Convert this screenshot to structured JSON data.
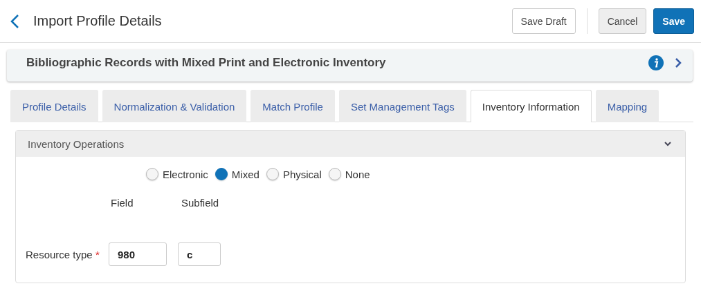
{
  "header": {
    "title": "Import Profile Details",
    "buttons": [
      {
        "label": "Save Draft",
        "kind": "outline"
      },
      {
        "label": "Cancel",
        "kind": "grey"
      },
      {
        "label": "Save",
        "kind": "primary"
      }
    ]
  },
  "profile_bar": {
    "title": "Bibliographic Records with Mixed Print and Electronic Inventory"
  },
  "tabs": [
    {
      "label": "Profile Details",
      "selected": false
    },
    {
      "label": "Normalization & Validation",
      "selected": false
    },
    {
      "label": "Match Profile",
      "selected": false
    },
    {
      "label": "Set Management Tags",
      "selected": false
    },
    {
      "label": "Inventory Information",
      "selected": true
    },
    {
      "label": "Mapping",
      "selected": false
    }
  ],
  "section": {
    "title": "Inventory Operations",
    "expanded": true,
    "options": [
      {
        "label": "Electronic",
        "selected": false
      },
      {
        "label": "Mixed",
        "selected": true
      },
      {
        "label": "Physical",
        "selected": false
      },
      {
        "label": "None",
        "selected": false
      }
    ],
    "column_headers": [
      "Field",
      "Subfield"
    ],
    "rows": [
      {
        "label": "Resource type",
        "required_mark": "*",
        "field": "980",
        "subfield": "c"
      }
    ]
  }
}
